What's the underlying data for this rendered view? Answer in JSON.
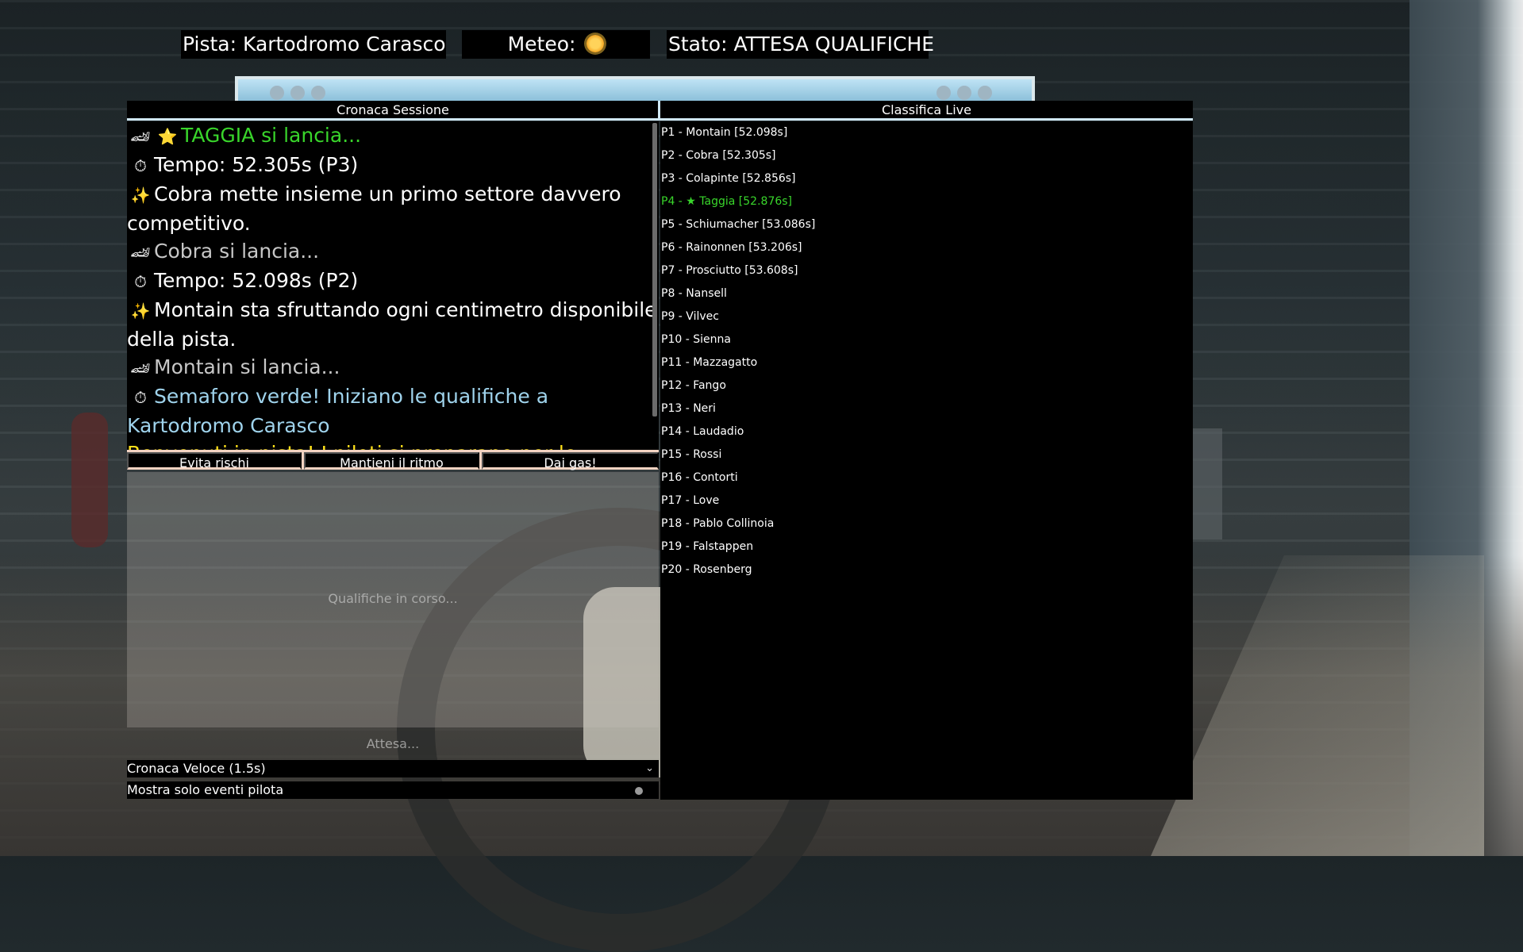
{
  "header": {
    "pista": "Pista: Kartodromo Carasco",
    "meteo_label": "Meteo:",
    "meteo_icon": "sun-icon",
    "stato": "Stato: ATTESA QUALIFICHE"
  },
  "panels": {
    "cronaca_title": "Cronaca Sessione",
    "classifica_title": "Classifica Live"
  },
  "feed": [
    {
      "icon": "🏎",
      "star": "⭐",
      "text": "TAGGIA si lancia...",
      "color": "green"
    },
    {
      "icon": "⏱",
      "text": "Tempo: 52.305s (P3)",
      "color": "white"
    },
    {
      "icon": "✨",
      "text": "Cobra mette insieme un primo settore davvero competitivo.",
      "color": "white"
    },
    {
      "icon": "🏎",
      "text": "Cobra si lancia...",
      "color": "gray"
    },
    {
      "icon": "⏱",
      "text": "Tempo: 52.098s (P2)",
      "color": "white"
    },
    {
      "icon": "✨",
      "text": "Montain sta sfruttando ogni centimetro disponibile della pista.",
      "color": "white"
    },
    {
      "icon": "🏎",
      "text": "Montain si lancia...",
      "color": "gray"
    },
    {
      "icon": "⏱",
      "text": "Semaforo verde! Iniziano le qualifiche a Kartodromo Carasco",
      "color": "blue"
    },
    {
      "icon": "",
      "text": "Benvenuti in pista! I piloti si preparano per le",
      "color": "yellow"
    }
  ],
  "actions": {
    "btn1": "Evita rischi",
    "btn2": "Mantieni il ritmo",
    "btn3": "Dai gas!"
  },
  "status": {
    "qualifying": "Qualifiche in corso...",
    "waiting": "Attesa..."
  },
  "controls": {
    "speed_selected": "Cronaca Veloce (1.5s)",
    "filter_label": "Mostra solo eventi pilota"
  },
  "standings": [
    {
      "text": "P1 - Montain  [52.098s]",
      "highlight": false
    },
    {
      "text": "P2 - Cobra  [52.305s]",
      "highlight": false
    },
    {
      "text": "P3 - Colapinte  [52.856s]",
      "highlight": false
    },
    {
      "text": "P4 - ★ Taggia  [52.876s]",
      "highlight": true
    },
    {
      "text": "P5 - Schiumacher  [53.086s]",
      "highlight": false
    },
    {
      "text": "P6 - Rainonnen  [53.206s]",
      "highlight": false
    },
    {
      "text": "P7 - Prosciutto  [53.608s]",
      "highlight": false
    },
    {
      "text": "P8 - Nansell",
      "highlight": false
    },
    {
      "text": "P9 - Vilvec",
      "highlight": false
    },
    {
      "text": "P10 - Sienna",
      "highlight": false
    },
    {
      "text": "P11 - Mazzagatto",
      "highlight": false
    },
    {
      "text": "P12 - Fango",
      "highlight": false
    },
    {
      "text": "P13 - Neri",
      "highlight": false
    },
    {
      "text": "P14 - Laudadio",
      "highlight": false
    },
    {
      "text": "P15 - Rossi",
      "highlight": false
    },
    {
      "text": "P16 - Contorti",
      "highlight": false
    },
    {
      "text": "P17 - Love",
      "highlight": false
    },
    {
      "text": "P18 - Pablo Collinoia",
      "highlight": false
    },
    {
      "text": "P19 - Falstappen",
      "highlight": false
    },
    {
      "text": "P20 - Rosenberg",
      "highlight": false
    }
  ],
  "colors": {
    "highlight_green": "#39d62b",
    "announce_yellow": "#ffe11a",
    "info_blue": "#9fd3ec",
    "panel_bg": "#000000"
  }
}
